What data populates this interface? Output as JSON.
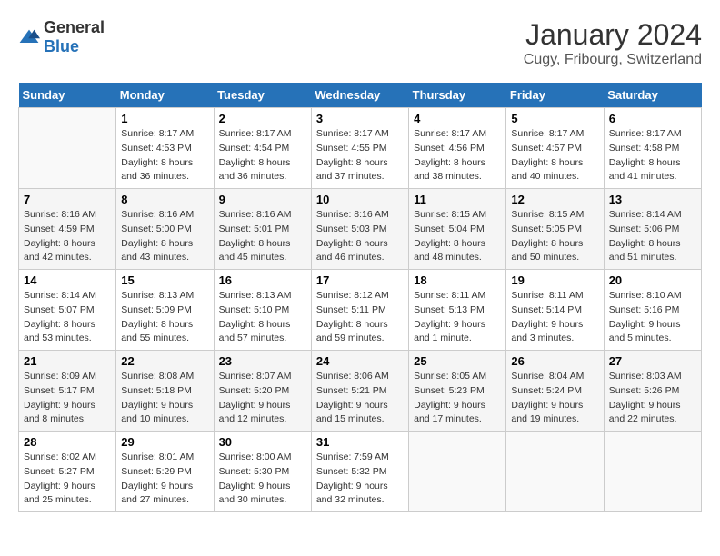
{
  "header": {
    "logo": {
      "general": "General",
      "blue": "Blue"
    },
    "title": "January 2024",
    "location": "Cugy, Fribourg, Switzerland"
  },
  "calendar": {
    "weekdays": [
      "Sunday",
      "Monday",
      "Tuesday",
      "Wednesday",
      "Thursday",
      "Friday",
      "Saturday"
    ],
    "weeks": [
      [
        {
          "day": "",
          "empty": true
        },
        {
          "day": "1",
          "sunrise": "Sunrise: 8:17 AM",
          "sunset": "Sunset: 4:53 PM",
          "daylight": "Daylight: 8 hours and 36 minutes."
        },
        {
          "day": "2",
          "sunrise": "Sunrise: 8:17 AM",
          "sunset": "Sunset: 4:54 PM",
          "daylight": "Daylight: 8 hours and 36 minutes."
        },
        {
          "day": "3",
          "sunrise": "Sunrise: 8:17 AM",
          "sunset": "Sunset: 4:55 PM",
          "daylight": "Daylight: 8 hours and 37 minutes."
        },
        {
          "day": "4",
          "sunrise": "Sunrise: 8:17 AM",
          "sunset": "Sunset: 4:56 PM",
          "daylight": "Daylight: 8 hours and 38 minutes."
        },
        {
          "day": "5",
          "sunrise": "Sunrise: 8:17 AM",
          "sunset": "Sunset: 4:57 PM",
          "daylight": "Daylight: 8 hours and 40 minutes."
        },
        {
          "day": "6",
          "sunrise": "Sunrise: 8:17 AM",
          "sunset": "Sunset: 4:58 PM",
          "daylight": "Daylight: 8 hours and 41 minutes."
        }
      ],
      [
        {
          "day": "7",
          "sunrise": "Sunrise: 8:16 AM",
          "sunset": "Sunset: 4:59 PM",
          "daylight": "Daylight: 8 hours and 42 minutes."
        },
        {
          "day": "8",
          "sunrise": "Sunrise: 8:16 AM",
          "sunset": "Sunset: 5:00 PM",
          "daylight": "Daylight: 8 hours and 43 minutes."
        },
        {
          "day": "9",
          "sunrise": "Sunrise: 8:16 AM",
          "sunset": "Sunset: 5:01 PM",
          "daylight": "Daylight: 8 hours and 45 minutes."
        },
        {
          "day": "10",
          "sunrise": "Sunrise: 8:16 AM",
          "sunset": "Sunset: 5:03 PM",
          "daylight": "Daylight: 8 hours and 46 minutes."
        },
        {
          "day": "11",
          "sunrise": "Sunrise: 8:15 AM",
          "sunset": "Sunset: 5:04 PM",
          "daylight": "Daylight: 8 hours and 48 minutes."
        },
        {
          "day": "12",
          "sunrise": "Sunrise: 8:15 AM",
          "sunset": "Sunset: 5:05 PM",
          "daylight": "Daylight: 8 hours and 50 minutes."
        },
        {
          "day": "13",
          "sunrise": "Sunrise: 8:14 AM",
          "sunset": "Sunset: 5:06 PM",
          "daylight": "Daylight: 8 hours and 51 minutes."
        }
      ],
      [
        {
          "day": "14",
          "sunrise": "Sunrise: 8:14 AM",
          "sunset": "Sunset: 5:07 PM",
          "daylight": "Daylight: 8 hours and 53 minutes."
        },
        {
          "day": "15",
          "sunrise": "Sunrise: 8:13 AM",
          "sunset": "Sunset: 5:09 PM",
          "daylight": "Daylight: 8 hours and 55 minutes."
        },
        {
          "day": "16",
          "sunrise": "Sunrise: 8:13 AM",
          "sunset": "Sunset: 5:10 PM",
          "daylight": "Daylight: 8 hours and 57 minutes."
        },
        {
          "day": "17",
          "sunrise": "Sunrise: 8:12 AM",
          "sunset": "Sunset: 5:11 PM",
          "daylight": "Daylight: 8 hours and 59 minutes."
        },
        {
          "day": "18",
          "sunrise": "Sunrise: 8:11 AM",
          "sunset": "Sunset: 5:13 PM",
          "daylight": "Daylight: 9 hours and 1 minute."
        },
        {
          "day": "19",
          "sunrise": "Sunrise: 8:11 AM",
          "sunset": "Sunset: 5:14 PM",
          "daylight": "Daylight: 9 hours and 3 minutes."
        },
        {
          "day": "20",
          "sunrise": "Sunrise: 8:10 AM",
          "sunset": "Sunset: 5:16 PM",
          "daylight": "Daylight: 9 hours and 5 minutes."
        }
      ],
      [
        {
          "day": "21",
          "sunrise": "Sunrise: 8:09 AM",
          "sunset": "Sunset: 5:17 PM",
          "daylight": "Daylight: 9 hours and 8 minutes."
        },
        {
          "day": "22",
          "sunrise": "Sunrise: 8:08 AM",
          "sunset": "Sunset: 5:18 PM",
          "daylight": "Daylight: 9 hours and 10 minutes."
        },
        {
          "day": "23",
          "sunrise": "Sunrise: 8:07 AM",
          "sunset": "Sunset: 5:20 PM",
          "daylight": "Daylight: 9 hours and 12 minutes."
        },
        {
          "day": "24",
          "sunrise": "Sunrise: 8:06 AM",
          "sunset": "Sunset: 5:21 PM",
          "daylight": "Daylight: 9 hours and 15 minutes."
        },
        {
          "day": "25",
          "sunrise": "Sunrise: 8:05 AM",
          "sunset": "Sunset: 5:23 PM",
          "daylight": "Daylight: 9 hours and 17 minutes."
        },
        {
          "day": "26",
          "sunrise": "Sunrise: 8:04 AM",
          "sunset": "Sunset: 5:24 PM",
          "daylight": "Daylight: 9 hours and 19 minutes."
        },
        {
          "day": "27",
          "sunrise": "Sunrise: 8:03 AM",
          "sunset": "Sunset: 5:26 PM",
          "daylight": "Daylight: 9 hours and 22 minutes."
        }
      ],
      [
        {
          "day": "28",
          "sunrise": "Sunrise: 8:02 AM",
          "sunset": "Sunset: 5:27 PM",
          "daylight": "Daylight: 9 hours and 25 minutes."
        },
        {
          "day": "29",
          "sunrise": "Sunrise: 8:01 AM",
          "sunset": "Sunset: 5:29 PM",
          "daylight": "Daylight: 9 hours and 27 minutes."
        },
        {
          "day": "30",
          "sunrise": "Sunrise: 8:00 AM",
          "sunset": "Sunset: 5:30 PM",
          "daylight": "Daylight: 9 hours and 30 minutes."
        },
        {
          "day": "31",
          "sunrise": "Sunrise: 7:59 AM",
          "sunset": "Sunset: 5:32 PM",
          "daylight": "Daylight: 9 hours and 32 minutes."
        },
        {
          "day": "",
          "empty": true
        },
        {
          "day": "",
          "empty": true
        },
        {
          "day": "",
          "empty": true
        }
      ]
    ]
  }
}
